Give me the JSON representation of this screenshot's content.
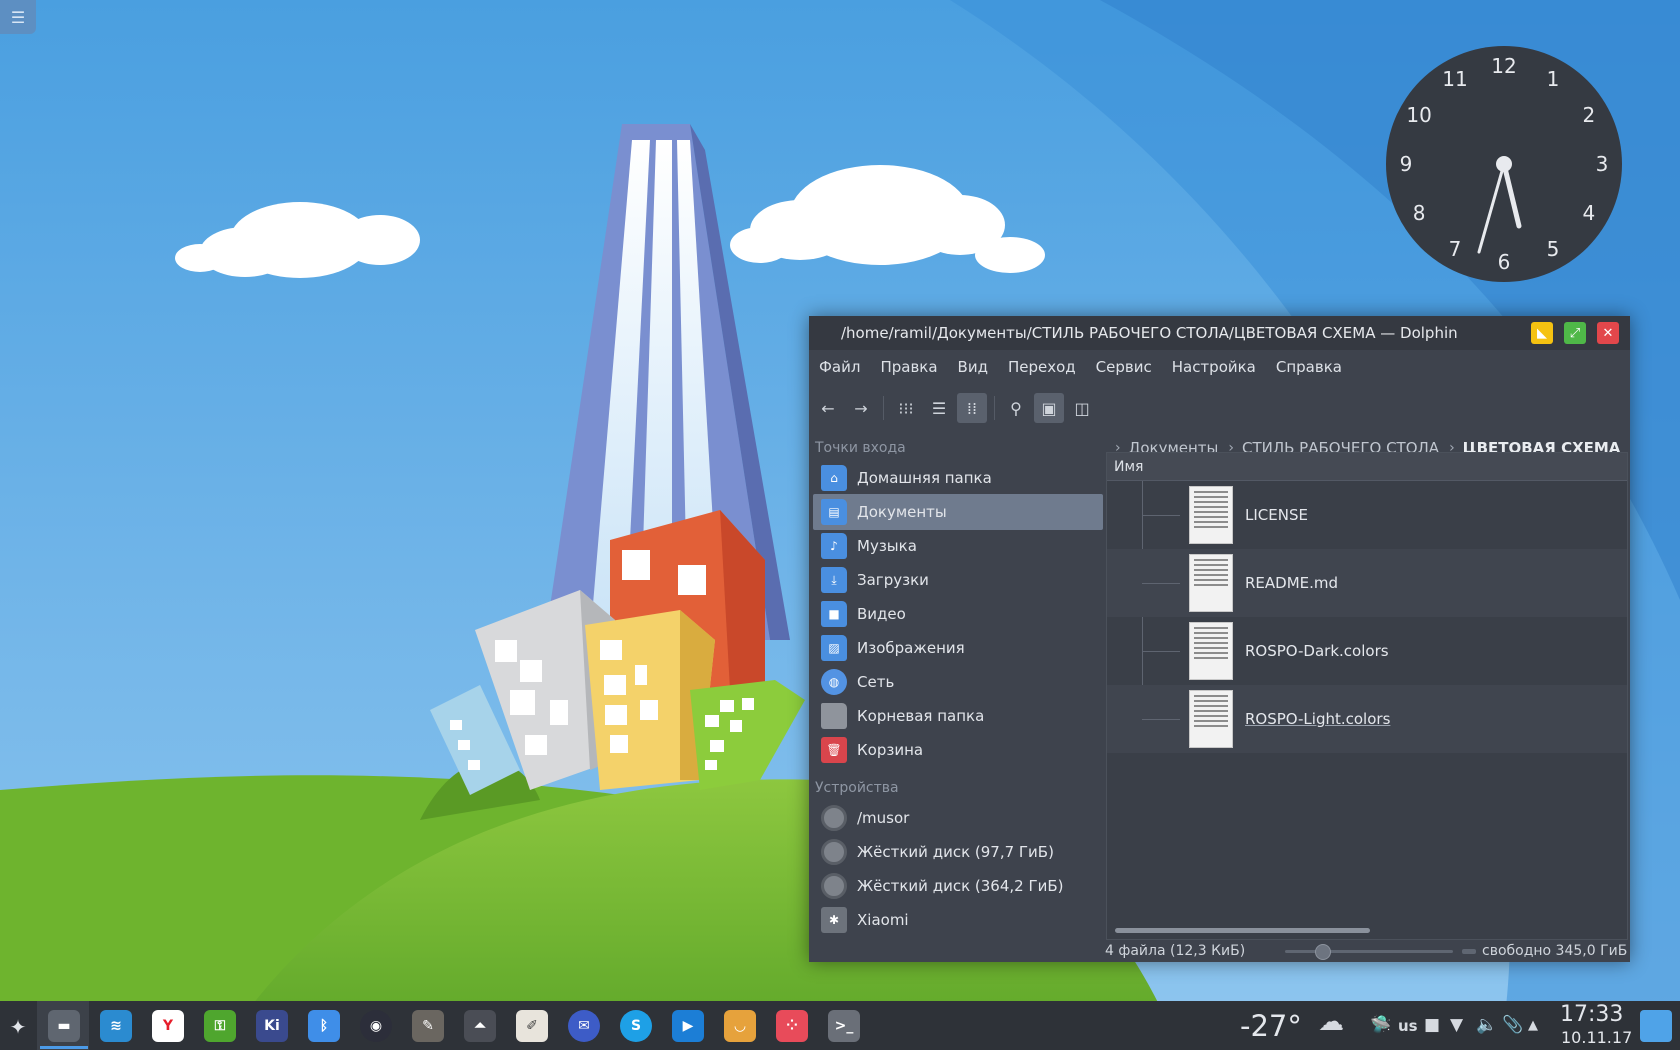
{
  "clock": {
    "numerals": [
      "12",
      "1",
      "2",
      "3",
      "4",
      "5",
      "6",
      "7",
      "8",
      "9",
      "10",
      "11"
    ]
  },
  "window": {
    "title": "/home/ramil/Документы/СТИЛЬ РАБОЧЕГО СТОЛА/ЦВЕТОВАЯ СХЕМА — Dolphin",
    "buttons": {
      "minimize_icon": "minimize-icon",
      "maximize_icon": "maximize-icon",
      "close_icon": "close-icon"
    },
    "colors": {
      "minimize": "#f5c211",
      "maximize": "#4fb848",
      "close": "#e2474b"
    }
  },
  "menu": [
    "Файл",
    "Правка",
    "Вид",
    "Переход",
    "Сервис",
    "Настройка",
    "Справка"
  ],
  "places": {
    "section_entry": "Точки входа",
    "entries": [
      {
        "label": "Домашняя папка",
        "icon": "home-folder-icon"
      },
      {
        "label": "Документы",
        "icon": "documents-folder-icon",
        "selected": true
      },
      {
        "label": "Музыка",
        "icon": "music-folder-icon"
      },
      {
        "label": "Загрузки",
        "icon": "downloads-folder-icon"
      },
      {
        "label": "Видео",
        "icon": "video-folder-icon"
      },
      {
        "label": "Изображения",
        "icon": "pictures-folder-icon"
      },
      {
        "label": "Сеть",
        "icon": "network-icon"
      },
      {
        "label": "Корневая папка",
        "icon": "root-folder-icon"
      },
      {
        "label": "Корзина",
        "icon": "trash-icon"
      }
    ],
    "section_devices": "Устройства",
    "devices": [
      {
        "label": "/musor",
        "icon": "drive-icon"
      },
      {
        "label": "Жёсткий диск (97,7 ГиБ)",
        "icon": "drive-icon"
      },
      {
        "label": "Жёсткий диск (364,2 ГиБ)",
        "icon": "drive-icon"
      },
      {
        "label": "Xiaomi",
        "icon": "phone-icon"
      }
    ]
  },
  "breadcrumb": [
    "Документы",
    "СТИЛЬ РАБОЧЕГО СТОЛА",
    "ЦВЕТОВАЯ СХЕМА"
  ],
  "files": {
    "column_name": "Имя",
    "items": [
      "LICENSE",
      "README.md",
      "ROSPO-Dark.colors",
      "ROSPO-Light.colors"
    ]
  },
  "status": {
    "summary": "4 файла (12,3 КиБ)",
    "free": "свободно 345,0 ГиБ",
    "zoom_level": 0.22
  },
  "taskbar": {
    "apps": [
      "Dolphin",
      "Pale Moon",
      "Yandex Browser",
      "KeePassXC",
      "Kirigami Gallery",
      "Bitwarden",
      "OBS",
      "GIMP",
      "Inkscape",
      "Calendar",
      "Thunderbird",
      "Skype",
      "Video",
      "Shopping",
      "Gnome Flashback",
      "Terminal"
    ],
    "temperature": "-27°",
    "keyboard": "us",
    "time": "17:33",
    "date": "10.11.17"
  }
}
